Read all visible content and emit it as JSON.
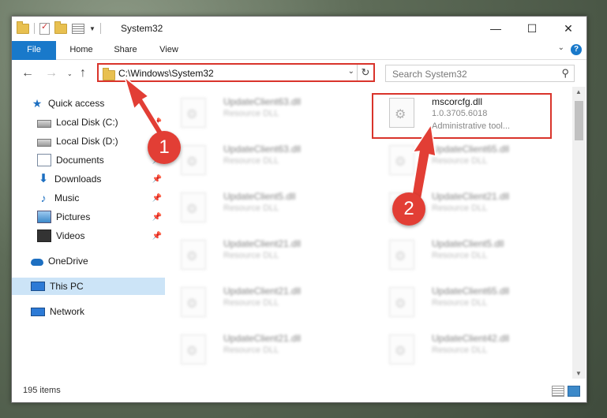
{
  "window": {
    "title": "System32"
  },
  "ribbon": {
    "tabs": [
      "File",
      "Home",
      "Share",
      "View"
    ],
    "help": "?"
  },
  "navigation": {
    "back": "←",
    "forward": "→",
    "up": "↑",
    "address": "C:\\Windows\\System32",
    "search_placeholder": "Search System32"
  },
  "sidebar": {
    "items": [
      {
        "label": "Quick access",
        "icon": "star-icon",
        "pinned": false
      },
      {
        "label": "Local Disk (C:)",
        "icon": "drive-icon",
        "pinned": true
      },
      {
        "label": "Local Disk (D:)",
        "icon": "drive-icon",
        "pinned": false
      },
      {
        "label": "Documents",
        "icon": "documents-icon",
        "pinned": true
      },
      {
        "label": "Downloads",
        "icon": "downloads-icon",
        "pinned": true
      },
      {
        "label": "Music",
        "icon": "music-icon",
        "pinned": true
      },
      {
        "label": "Pictures",
        "icon": "pictures-icon",
        "pinned": true
      },
      {
        "label": "Videos",
        "icon": "videos-icon",
        "pinned": true
      },
      {
        "label": "OneDrive",
        "icon": "onedrive-icon",
        "pinned": false
      },
      {
        "label": "This PC",
        "icon": "this-pc-icon",
        "pinned": false,
        "selected": true
      },
      {
        "label": "Network",
        "icon": "network-icon",
        "pinned": false
      }
    ]
  },
  "files": {
    "highlighted": {
      "name": "mscorcfg.dll",
      "version": "1.0.3705.6018",
      "description": "Administrative tool..."
    },
    "blurred": [
      {
        "name": "UpdateClient63.dll",
        "type": "Resource DLL"
      },
      {
        "name": "UpdateClient63.dll",
        "type": "Resource DLL"
      },
      {
        "name": "UpdateClient65.dll",
        "type": "Resource DLL"
      },
      {
        "name": "UpdateClient5.dll",
        "type": "Resource DLL"
      },
      {
        "name": "UpdateClient21.dll",
        "type": "Resource DLL"
      },
      {
        "name": "UpdateClient21.dll",
        "type": "Resource DLL"
      },
      {
        "name": "UpdateClient5.dll",
        "type": "Resource DLL"
      },
      {
        "name": "UpdateClient21.dll",
        "type": "Resource DLL"
      },
      {
        "name": "UpdateClient65.dll",
        "type": "Resource DLL"
      },
      {
        "name": "UpdateClient21.dll",
        "type": "Resource DLL"
      },
      {
        "name": "UpdateClient21.dll",
        "type": "Resource DLL"
      },
      {
        "name": "UpdateClient21.dll",
        "type": "Resource DLL"
      },
      {
        "name": "UpdateClient42.dll",
        "type": "Resource DLL"
      }
    ]
  },
  "status": {
    "item_count": "195 items"
  },
  "callouts": {
    "one": "1",
    "two": "2"
  },
  "colors": {
    "accent": "#1979ca",
    "highlight": "#d9342b",
    "callout": "#e23e35",
    "selection": "#cce4f7"
  }
}
